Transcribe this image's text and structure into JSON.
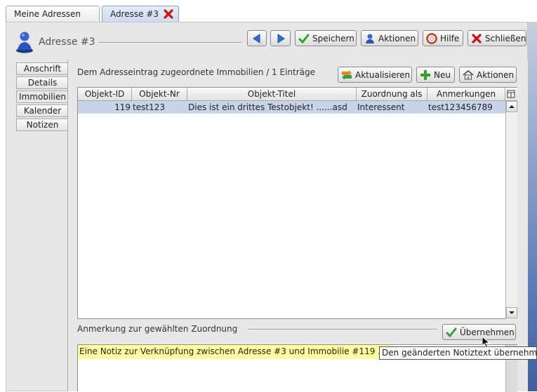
{
  "tabs": [
    {
      "label": "Meine Adressen",
      "active": false
    },
    {
      "label": "Adresse #3",
      "active": true
    }
  ],
  "header": {
    "title": "Adresse #3"
  },
  "toolbar": {
    "save_label": "Speichern",
    "actions_label": "Aktionen",
    "help_label": "Hilfe",
    "close_label": "Schließen"
  },
  "sidebar": {
    "items": [
      {
        "label": "Anschrift"
      },
      {
        "label": "Details"
      },
      {
        "label": "Immobilien"
      },
      {
        "label": "Kalender"
      },
      {
        "label": "Notizen"
      }
    ]
  },
  "main": {
    "section_title": "Dem Adresseintrag zugeordnete Immobilien / 1 Einträge",
    "refresh_label": "Aktualisieren",
    "new_label": "Neu",
    "actions_label": "Aktionen",
    "table": {
      "columns": [
        "Objekt-ID",
        "Objekt-Nr",
        "Objekt-Titel",
        "Zuordnung als",
        "Anmerkungen"
      ],
      "rows": [
        {
          "id": "119",
          "nr": "test123",
          "title": "Dies ist ein drittes Testobjekt! ......asd",
          "assignment": "Interessent",
          "notes": "test123456789"
        }
      ]
    },
    "note_title": "Anmerkung zur gewählten Zuordnung",
    "apply_label": "Übernehmen",
    "note_text": "Eine Notiz zur Verknüpfung zwischen Adresse #3 und Immobilie #119 ......",
    "tooltip": "Den geänderten Notiztext übernehmen"
  },
  "colors": {
    "selection": "#c8d4ea",
    "note_highlight": "#ffff9e",
    "accent_blue": "#2a6fd6",
    "close_red": "#d01010",
    "check_green": "#2fa12f"
  },
  "icons": {
    "user": "user-icon",
    "close": "close-icon",
    "prev": "arrow-left-icon",
    "next": "arrow-right-icon",
    "save": "checkmark-icon",
    "help": "lifebuoy-icon",
    "refresh": "refresh-icon",
    "new": "plus-icon",
    "house": "house-icon"
  }
}
